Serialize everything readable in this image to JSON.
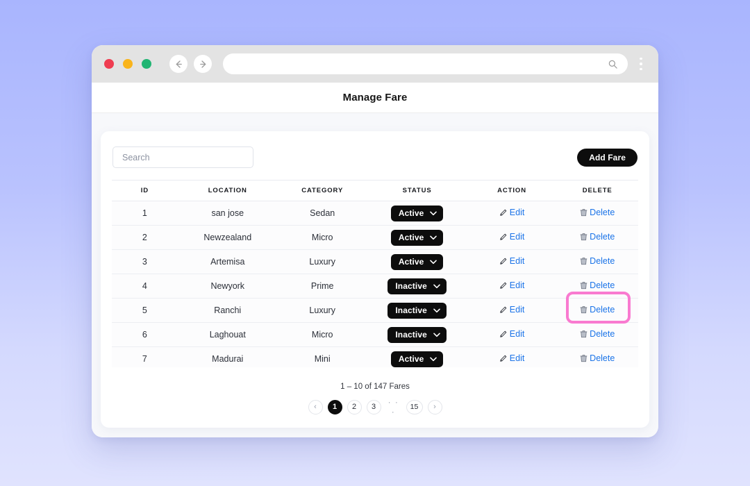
{
  "browser": {
    "traffic_lights": [
      "close",
      "minimize",
      "maximize"
    ],
    "back_label": "back-arrow",
    "forward_label": "forward-arrow",
    "url_value": "",
    "url_placeholder": "",
    "search_icon": "search-icon",
    "menu_icon": "kebab-menu-icon"
  },
  "header": {
    "title": "Manage Fare"
  },
  "toolbar": {
    "search_value": "",
    "search_placeholder": "Search",
    "add_label": "Add Fare"
  },
  "table": {
    "columns": [
      "ID",
      "LOCATION",
      "CATEGORY",
      "STATUS",
      "ACTION",
      "DELETE"
    ],
    "action_label": "Edit",
    "delete_label": "Delete",
    "edit_icon": "pencil-icon",
    "delete_icon": "trash-icon",
    "chevron_icon": "chevron-down-icon",
    "rows": [
      {
        "id": "1",
        "location": "san jose",
        "category": "Sedan",
        "status": "Active"
      },
      {
        "id": "2",
        "location": "Newzealand",
        "category": "Micro",
        "status": "Active"
      },
      {
        "id": "3",
        "location": "Artemisa",
        "category": "Luxury",
        "status": "Active"
      },
      {
        "id": "4",
        "location": "Newyork",
        "category": "Prime",
        "status": "Inactive"
      },
      {
        "id": "5",
        "location": "Ranchi",
        "category": "Luxury",
        "status": "Inactive"
      },
      {
        "id": "6",
        "location": "Laghouat",
        "category": "Micro",
        "status": "Inactive"
      },
      {
        "id": "7",
        "location": "Madurai",
        "category": "Mini",
        "status": "Active"
      }
    ]
  },
  "pagination": {
    "summary": "1 – 10 of 147 Fares",
    "prev": "‹",
    "next": "›",
    "ellipsis": "· · ·",
    "pages": [
      "1",
      "2",
      "3",
      "15"
    ],
    "active_page": "1"
  },
  "highlight": {
    "target": "row-1-edit-link",
    "color": "#f97ad0"
  },
  "colors": {
    "accent_link": "#1a73e8",
    "pill_bg": "#0d0d0d",
    "bg_top": "#a9b5fe",
    "bg_bottom": "#e0e3fe"
  }
}
